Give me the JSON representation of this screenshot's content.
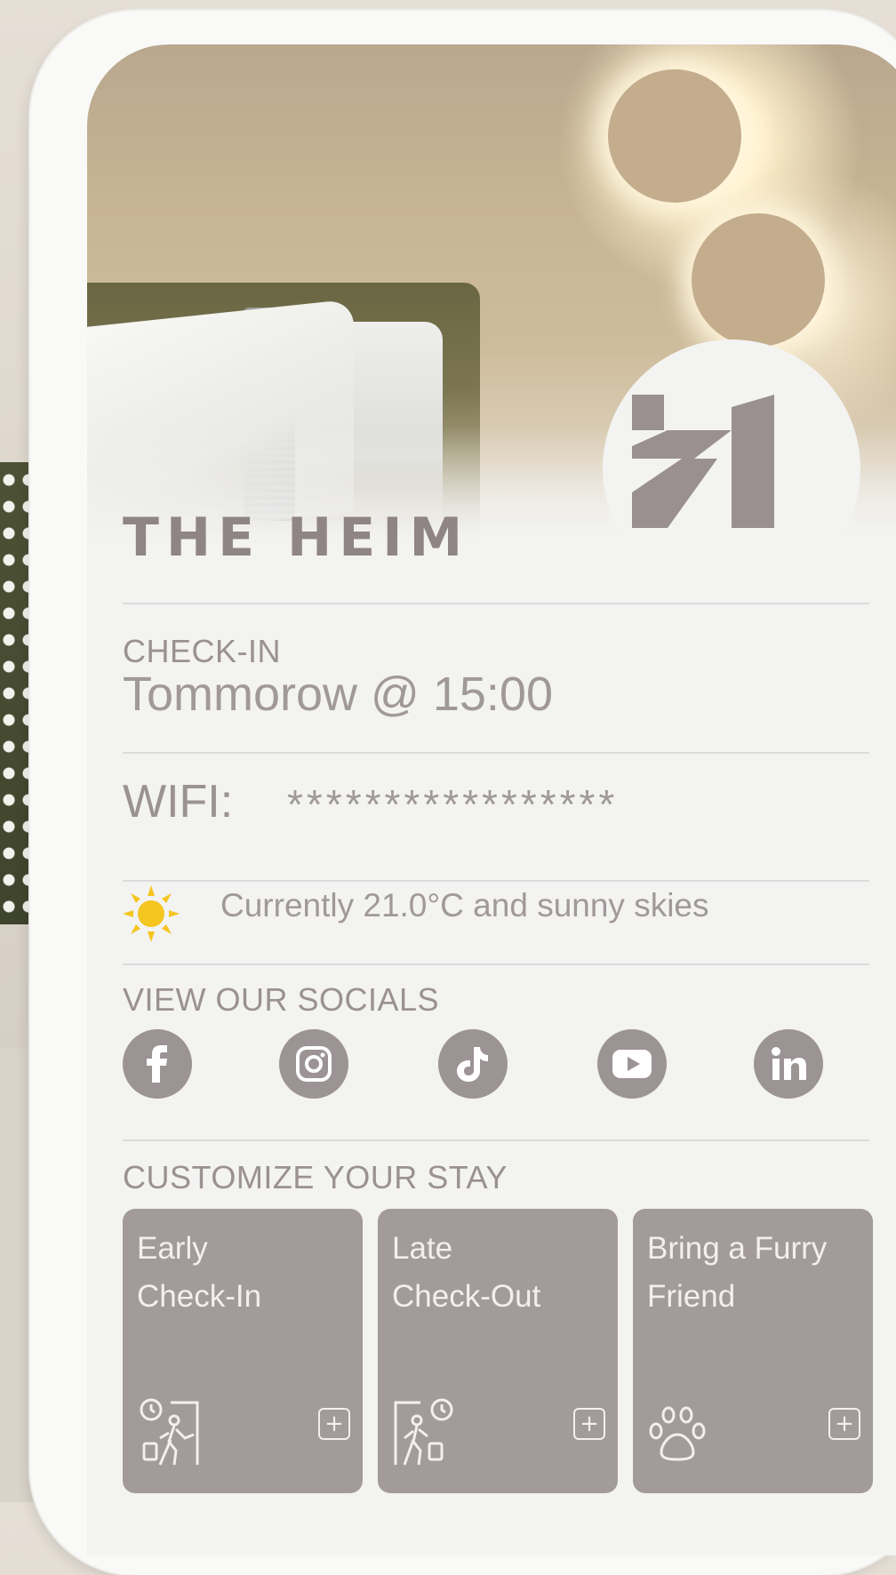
{
  "hotel": {
    "name": "THE HEIM"
  },
  "checkin": {
    "label": "CHECK-IN",
    "value": "Tommorow @ 15:00"
  },
  "wifi": {
    "label": "WIFI:",
    "value": "*****************"
  },
  "weather": {
    "text": "Currently 21.0°C and sunny skies",
    "icon": "sun-icon",
    "icon_color": "#f5c520"
  },
  "socials": {
    "heading": "VIEW OUR SOCIALS",
    "items": [
      {
        "name": "facebook-icon"
      },
      {
        "name": "instagram-icon"
      },
      {
        "name": "tiktok-icon"
      },
      {
        "name": "youtube-icon"
      },
      {
        "name": "linkedin-icon"
      }
    ]
  },
  "customize": {
    "heading": "CUSTOMIZE YOUR STAY",
    "cards": [
      {
        "line1": "Early",
        "line2": "Check-In",
        "icon": "early-checkin-icon"
      },
      {
        "line1": "Late",
        "line2": "Check-Out",
        "icon": "late-checkout-icon"
      },
      {
        "line1": "Bring a Furry",
        "line2": "Friend",
        "icon": "paw-icon"
      }
    ],
    "add_symbol": "+"
  },
  "colors": {
    "accent": "#9c9394",
    "card": "#a39a9a",
    "background": "#f3f3f2"
  }
}
